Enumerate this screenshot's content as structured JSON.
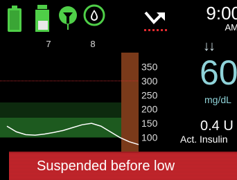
{
  "status": {
    "time": "9:00",
    "ampm": "AM",
    "alert_counts": {
      "reservoir": "7",
      "calibration": "8"
    }
  },
  "glucose": {
    "trend_arrows": "↓↓",
    "value": "60",
    "units": "mg/dL",
    "active_insulin_value": "0.4 U",
    "active_insulin_label": "Act. Insulin"
  },
  "chart_data": {
    "type": "line",
    "y_ticks": [
      "350",
      "300",
      "250",
      "200",
      "150",
      "100"
    ],
    "ylim": [
      50,
      400
    ],
    "high_threshold": 300,
    "low_threshold": 75,
    "target_range": [
      100,
      170
    ],
    "series": [
      {
        "values": [
          140,
          120,
          110,
          108,
          112,
          118,
          125,
          135,
          145,
          150,
          140,
          120,
          100,
          85,
          75
        ]
      }
    ]
  },
  "colors": {
    "battery": "#4fcf48",
    "sensor": "#4fcf48",
    "trace": "#ffffff",
    "target_band": "#1d5a1f",
    "suspend_zone": "#7a3a1a",
    "high_line": "#c8292c",
    "banner": "#c7262c",
    "glucose_text": "#8fd3d9"
  },
  "banner": {
    "text": "Suspended before low"
  },
  "icons": [
    "battery-icon",
    "reservoir-icon",
    "calibration-icon",
    "sensor-drop-icon",
    "notification-arrow-icon"
  ]
}
